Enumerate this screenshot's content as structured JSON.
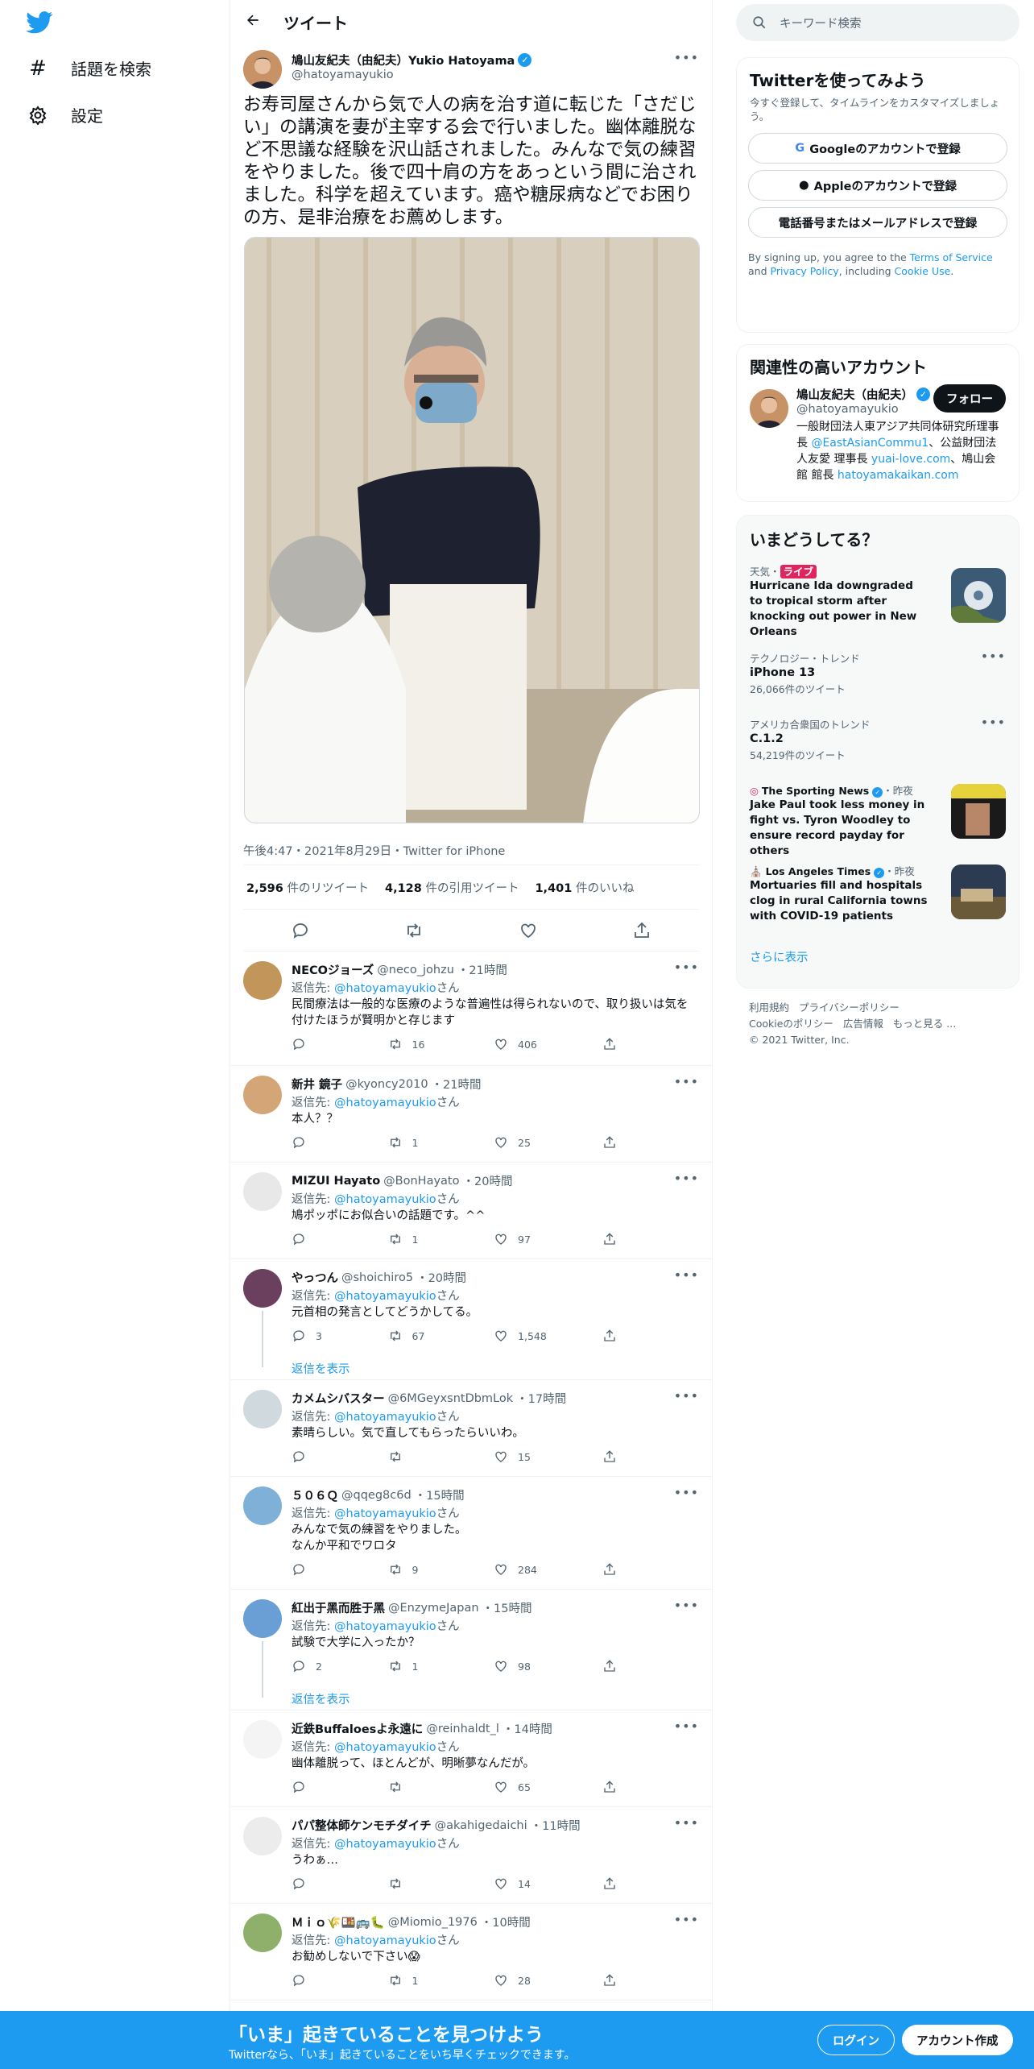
{
  "nav": {
    "explore": "話題を検索",
    "settings": "設定"
  },
  "header": {
    "title": "ツイート"
  },
  "tweet": {
    "name": "鳩山友紀夫（由紀夫）Yukio Hatoyama",
    "handle": "@hatoyamayukio",
    "text": "お寿司屋さんから気で人の病を治す道に転じた「さだじい」の講演を妻が主宰する会で行いました。幽体離脱など不思議な経験を沢山話されました。みんなで気の練習をやりました。後で四十肩の方をあっという間に治されました。科学を超えています。癌や糖尿病などでお困りの方、是非治療をお薦めします。",
    "meta": "午後4:47・2021年8月29日・Twitter for iPhone",
    "retweets": "2,596",
    "retweets_label": "件のリツイート",
    "quotes": "4,128",
    "quotes_label": "件の引用ツイート",
    "likes": "1,401",
    "likes_label": "件のいいね"
  },
  "replying_prefix": "返信先: ",
  "replying_handle": "@hatoyamayukio",
  "replying_suffix": "さん",
  "show_replies": "返信を表示",
  "replies": [
    {
      "name": "NECOジョーズ",
      "handle": "@neco_johzu",
      "time": "・21時間",
      "text": "民間療法は一般的な医療のような普遍性は得られないので、取り扱いは気を付けたほうが賢明かと存じます",
      "rt": "16",
      "like": "406",
      "reply": ""
    },
    {
      "name": "新井 鏡子",
      "handle": "@kyoncy2010",
      "time": "・21時間",
      "text": "本人？？",
      "rt": "1",
      "like": "25",
      "reply": ""
    },
    {
      "name": "MIZUI Hayato",
      "handle": "@BonHayato",
      "time": "・20時間",
      "text": "鳩ポッポにお似合いの話題です。^^",
      "rt": "1",
      "like": "97",
      "reply": ""
    },
    {
      "name": "やっつん",
      "handle": "@shoichiro5",
      "time": "・20時間",
      "text": "元首相の発言としてどうかしてる。",
      "rt": "67",
      "like": "1,548",
      "reply": "3"
    },
    {
      "name": "カメムシバスター",
      "handle": "@6MGeyxsntDbmLok",
      "time": "・17時間",
      "text": "素晴らしい。気で直してもらったらいいわ。",
      "rt": "",
      "like": "15",
      "reply": ""
    },
    {
      "name": "５０６Ｑ",
      "handle": "@qqeg8c6d",
      "time": "・15時間",
      "text": "みんなで気の練習をやりました。\nなんか平和でワロタ",
      "rt": "9",
      "like": "284",
      "reply": ""
    },
    {
      "name": "紅出于黑而胜于黑",
      "handle": "@EnzymeJapan",
      "time": "・15時間",
      "text": "試験で大学に入ったか？",
      "rt": "1",
      "like": "98",
      "reply": "2"
    },
    {
      "name": "近鉄Buffaloesよ永遠に",
      "handle": "@reinhaldt_l",
      "time": "・14時間",
      "text": "幽体離脱って、ほとんどが、明晰夢なんだが。",
      "rt": "",
      "like": "65",
      "reply": ""
    },
    {
      "name": "パパ整体師ケンモチダイチ",
      "handle": "@akahigedaichi",
      "time": "・11時間",
      "text": "うわぁ…",
      "rt": "",
      "like": "14",
      "reply": ""
    },
    {
      "name": "Ｍｉｏ🌾🍱🚌🐛",
      "handle": "@Miomio_1976",
      "time": "・10時間",
      "text": "お勧めしないで下さい😱",
      "rt": "1",
      "like": "28",
      "reply": ""
    }
  ],
  "right": {
    "search_placeholder": "キーワード検索",
    "signup": {
      "title": "Twitterを使ってみよう",
      "sub": "今すぐ登録して、タイムラインをカスタマイズしましょう。",
      "google": "Googleのアカウントで登録",
      "apple": "Appleのアカウントで登録",
      "phone": "電話番号またはメールアドレスで登録",
      "terms_a": "By signing up, you agree to the ",
      "terms_link": "Terms of Service",
      "terms_b": " and ",
      "privacy_link": "Privacy Policy",
      "terms_c": ", including ",
      "cookie_link": "Cookie Use",
      "terms_d": "."
    },
    "related": {
      "title": "関連性の高いアカウント",
      "name": "鳩山友紀夫（由紀夫）",
      "handle": "@hatoyamayukio",
      "follow": "フォロー",
      "bio_a": "一般財団法人東アジア共同体研究所理事長 ",
      "bio_l1": "@EastAsianCommu1",
      "bio_b": "、公益財団法人友愛 理事長 ",
      "bio_l2": "yuai-love.com",
      "bio_c": "、鳩山会館 館長 ",
      "bio_l3": "hatoyamakaikan.com"
    },
    "trends": {
      "title": "いまどうしてる？",
      "live_cat": "天気・",
      "live_badge": "ライブ",
      "live_text": "Hurricane Ida downgraded to tropical storm after knocking out power in New Orleans",
      "t1_cat": "テクノロジー・トレンド",
      "t1": "iPhone 13",
      "t1_cnt": "26,066件のツイート",
      "t2_cat": "アメリカ合衆国のトレンド",
      "t2": "C.1.2",
      "t2_cnt": "54,219件のツイート",
      "n1_src": "The Sporting News",
      "n1_time": "・昨夜",
      "n1": "Jake Paul took less money in fight vs. Tyron Woodley to ensure record payday for others",
      "n2_src": "Los Angeles Times",
      "n2_time": "・昨夜",
      "n2": "Mortuaries fill and hospitals clog in rural California towns with COVID-19 patients",
      "more": "さらに表示"
    },
    "footer": {
      "l1": "利用規約",
      "l2": "プライバシーポリシー",
      "l3": "Cookieのポリシー",
      "l4": "広告情報",
      "l5": "もっと見る ...",
      "copy": "© 2021 Twitter, Inc."
    }
  },
  "bottom": {
    "title": "「いま」起きていることを見つけよう",
    "sub": "Twitterなら、「いま」起きていることをいち早くチェックできます。",
    "login": "ログイン",
    "signup": "アカウント作成"
  },
  "colors": {
    "accent": "#1d9bf0",
    "live": "#e0245e"
  }
}
